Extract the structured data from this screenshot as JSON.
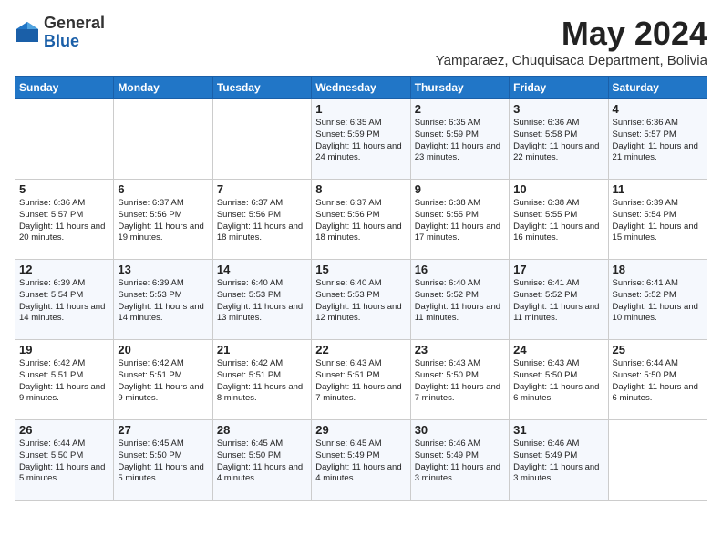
{
  "header": {
    "logo_general": "General",
    "logo_blue": "Blue",
    "month_year": "May 2024",
    "location": "Yamparaez, Chuquisaca Department, Bolivia"
  },
  "days_of_week": [
    "Sunday",
    "Monday",
    "Tuesday",
    "Wednesday",
    "Thursday",
    "Friday",
    "Saturday"
  ],
  "weeks": [
    [
      {
        "day": "",
        "text": ""
      },
      {
        "day": "",
        "text": ""
      },
      {
        "day": "",
        "text": ""
      },
      {
        "day": "1",
        "text": "Sunrise: 6:35 AM\nSunset: 5:59 PM\nDaylight: 11 hours and 24 minutes."
      },
      {
        "day": "2",
        "text": "Sunrise: 6:35 AM\nSunset: 5:59 PM\nDaylight: 11 hours and 23 minutes."
      },
      {
        "day": "3",
        "text": "Sunrise: 6:36 AM\nSunset: 5:58 PM\nDaylight: 11 hours and 22 minutes."
      },
      {
        "day": "4",
        "text": "Sunrise: 6:36 AM\nSunset: 5:57 PM\nDaylight: 11 hours and 21 minutes."
      }
    ],
    [
      {
        "day": "5",
        "text": "Sunrise: 6:36 AM\nSunset: 5:57 PM\nDaylight: 11 hours and 20 minutes."
      },
      {
        "day": "6",
        "text": "Sunrise: 6:37 AM\nSunset: 5:56 PM\nDaylight: 11 hours and 19 minutes."
      },
      {
        "day": "7",
        "text": "Sunrise: 6:37 AM\nSunset: 5:56 PM\nDaylight: 11 hours and 18 minutes."
      },
      {
        "day": "8",
        "text": "Sunrise: 6:37 AM\nSunset: 5:56 PM\nDaylight: 11 hours and 18 minutes."
      },
      {
        "day": "9",
        "text": "Sunrise: 6:38 AM\nSunset: 5:55 PM\nDaylight: 11 hours and 17 minutes."
      },
      {
        "day": "10",
        "text": "Sunrise: 6:38 AM\nSunset: 5:55 PM\nDaylight: 11 hours and 16 minutes."
      },
      {
        "day": "11",
        "text": "Sunrise: 6:39 AM\nSunset: 5:54 PM\nDaylight: 11 hours and 15 minutes."
      }
    ],
    [
      {
        "day": "12",
        "text": "Sunrise: 6:39 AM\nSunset: 5:54 PM\nDaylight: 11 hours and 14 minutes."
      },
      {
        "day": "13",
        "text": "Sunrise: 6:39 AM\nSunset: 5:53 PM\nDaylight: 11 hours and 14 minutes."
      },
      {
        "day": "14",
        "text": "Sunrise: 6:40 AM\nSunset: 5:53 PM\nDaylight: 11 hours and 13 minutes."
      },
      {
        "day": "15",
        "text": "Sunrise: 6:40 AM\nSunset: 5:53 PM\nDaylight: 11 hours and 12 minutes."
      },
      {
        "day": "16",
        "text": "Sunrise: 6:40 AM\nSunset: 5:52 PM\nDaylight: 11 hours and 11 minutes."
      },
      {
        "day": "17",
        "text": "Sunrise: 6:41 AM\nSunset: 5:52 PM\nDaylight: 11 hours and 11 minutes."
      },
      {
        "day": "18",
        "text": "Sunrise: 6:41 AM\nSunset: 5:52 PM\nDaylight: 11 hours and 10 minutes."
      }
    ],
    [
      {
        "day": "19",
        "text": "Sunrise: 6:42 AM\nSunset: 5:51 PM\nDaylight: 11 hours and 9 minutes."
      },
      {
        "day": "20",
        "text": "Sunrise: 6:42 AM\nSunset: 5:51 PM\nDaylight: 11 hours and 9 minutes."
      },
      {
        "day": "21",
        "text": "Sunrise: 6:42 AM\nSunset: 5:51 PM\nDaylight: 11 hours and 8 minutes."
      },
      {
        "day": "22",
        "text": "Sunrise: 6:43 AM\nSunset: 5:51 PM\nDaylight: 11 hours and 7 minutes."
      },
      {
        "day": "23",
        "text": "Sunrise: 6:43 AM\nSunset: 5:50 PM\nDaylight: 11 hours and 7 minutes."
      },
      {
        "day": "24",
        "text": "Sunrise: 6:43 AM\nSunset: 5:50 PM\nDaylight: 11 hours and 6 minutes."
      },
      {
        "day": "25",
        "text": "Sunrise: 6:44 AM\nSunset: 5:50 PM\nDaylight: 11 hours and 6 minutes."
      }
    ],
    [
      {
        "day": "26",
        "text": "Sunrise: 6:44 AM\nSunset: 5:50 PM\nDaylight: 11 hours and 5 minutes."
      },
      {
        "day": "27",
        "text": "Sunrise: 6:45 AM\nSunset: 5:50 PM\nDaylight: 11 hours and 5 minutes."
      },
      {
        "day": "28",
        "text": "Sunrise: 6:45 AM\nSunset: 5:50 PM\nDaylight: 11 hours and 4 minutes."
      },
      {
        "day": "29",
        "text": "Sunrise: 6:45 AM\nSunset: 5:49 PM\nDaylight: 11 hours and 4 minutes."
      },
      {
        "day": "30",
        "text": "Sunrise: 6:46 AM\nSunset: 5:49 PM\nDaylight: 11 hours and 3 minutes."
      },
      {
        "day": "31",
        "text": "Sunrise: 6:46 AM\nSunset: 5:49 PM\nDaylight: 11 hours and 3 minutes."
      },
      {
        "day": "",
        "text": ""
      }
    ]
  ]
}
